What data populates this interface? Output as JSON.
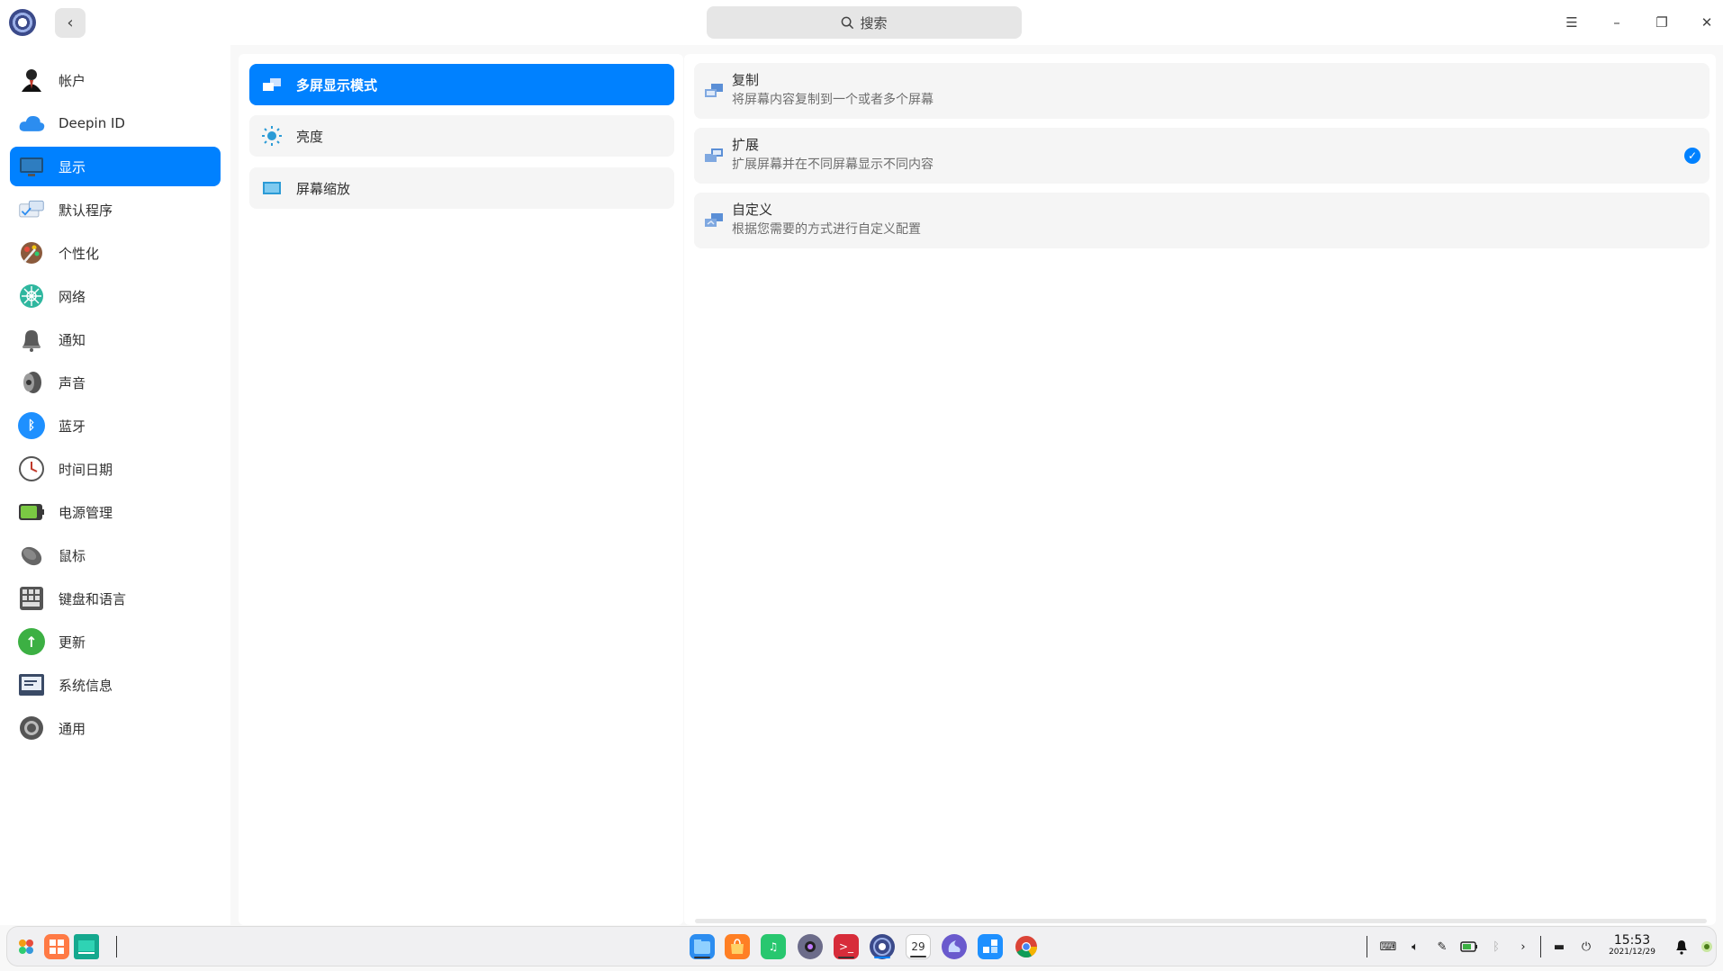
{
  "titlebar": {
    "search_placeholder": "搜索",
    "back_glyph": "‹",
    "menu_glyph": "☰",
    "minimize_glyph": "–",
    "maximize_glyph": "❐",
    "close_glyph": "✕"
  },
  "sidebar": {
    "items": [
      {
        "label": "帐户",
        "icon": "account-icon"
      },
      {
        "label": "Deepin ID",
        "icon": "cloud-icon"
      },
      {
        "label": "显示",
        "icon": "display-icon",
        "active": true
      },
      {
        "label": "默认程序",
        "icon": "default-apps-icon"
      },
      {
        "label": "个性化",
        "icon": "personalization-icon"
      },
      {
        "label": "网络",
        "icon": "network-icon"
      },
      {
        "label": "通知",
        "icon": "bell-icon"
      },
      {
        "label": "声音",
        "icon": "speaker-icon"
      },
      {
        "label": "蓝牙",
        "icon": "bluetooth-icon"
      },
      {
        "label": "时间日期",
        "icon": "clock-icon"
      },
      {
        "label": "电源管理",
        "icon": "battery-icon"
      },
      {
        "label": "鼠标",
        "icon": "mouse-icon"
      },
      {
        "label": "键盘和语言",
        "icon": "keyboard-icon"
      },
      {
        "label": "更新",
        "icon": "update-icon"
      },
      {
        "label": "系统信息",
        "icon": "system-info-icon"
      },
      {
        "label": "通用",
        "icon": "general-icon"
      }
    ]
  },
  "middle": {
    "items": [
      {
        "label": "多屏显示模式",
        "icon": "multi-screen-icon",
        "active": true
      },
      {
        "label": "亮度",
        "icon": "brightness-icon"
      },
      {
        "label": "屏幕缩放",
        "icon": "scale-icon"
      }
    ]
  },
  "content": {
    "options": [
      {
        "title": "复制",
        "desc": "将屏幕内容复制到一个或者多个屏幕",
        "icon": "duplicate-icon",
        "checked": false
      },
      {
        "title": "扩展",
        "desc": "扩展屏幕并在不同屏幕显示不同内容",
        "icon": "extend-icon",
        "checked": true
      },
      {
        "title": "自定义",
        "desc": "根据您需要的方式进行自定义配置",
        "icon": "custom-icon",
        "checked": false
      }
    ],
    "check_glyph": "✓"
  },
  "dock": {
    "calendar_day": "29",
    "time": "15:53",
    "date": "2021/12/29"
  },
  "colors": {
    "accent": "#0081ff",
    "sidebar_bg": "#ffffff",
    "window_bg": "#f8f8f8"
  }
}
